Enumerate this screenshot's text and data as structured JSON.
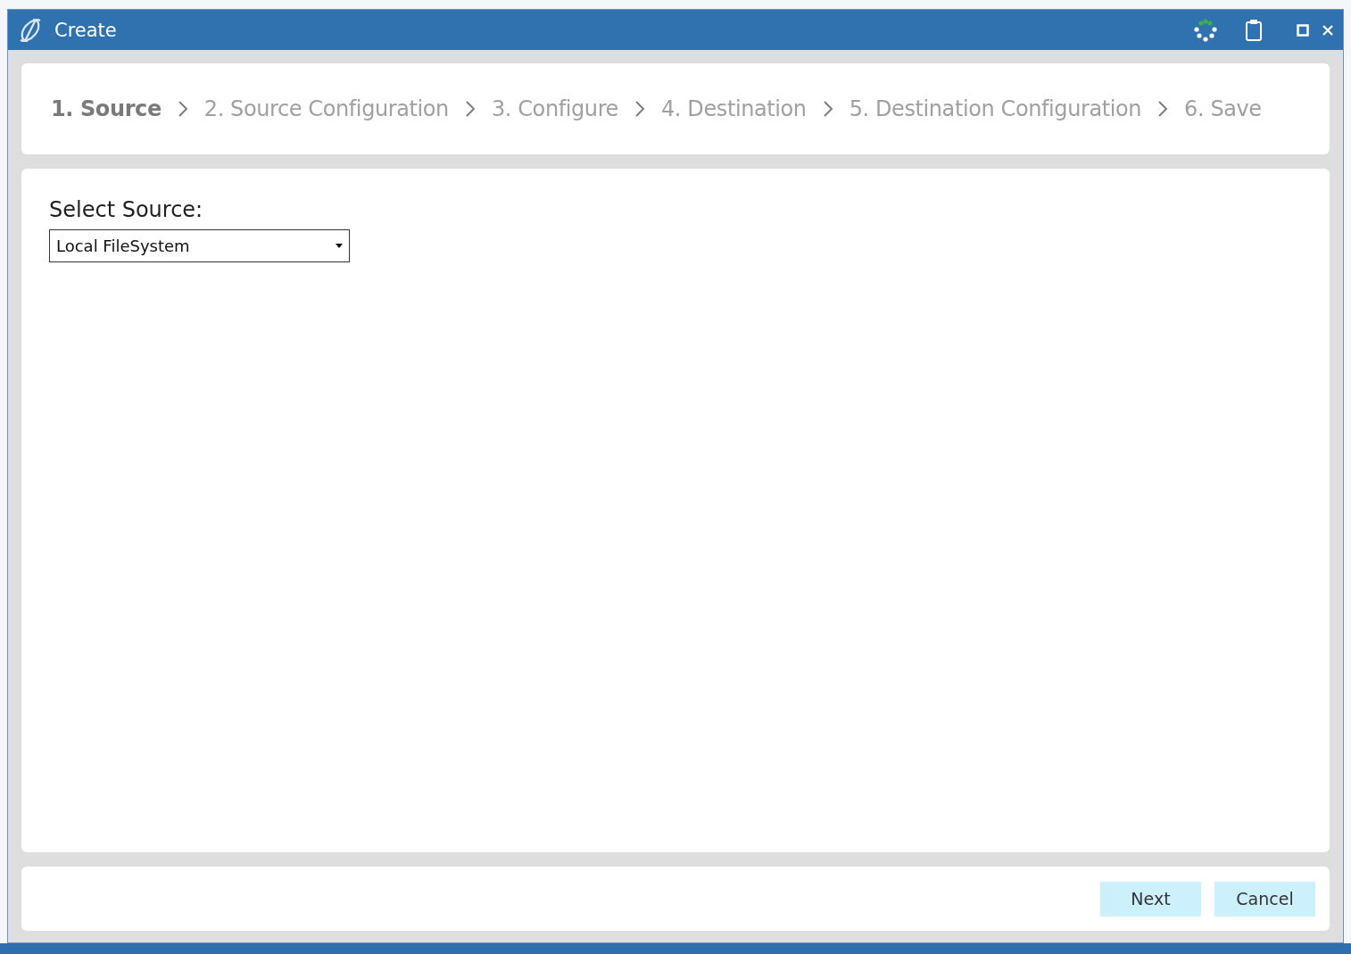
{
  "window": {
    "title": "Create"
  },
  "steps": [
    {
      "label": "1. Source",
      "selected": true
    },
    {
      "label": "2. Source Configuration",
      "selected": false
    },
    {
      "label": "3. Configure",
      "selected": false
    },
    {
      "label": "4. Destination",
      "selected": false
    },
    {
      "label": "5. Destination Configuration",
      "selected": false
    },
    {
      "label": "6. Save",
      "selected": false
    }
  ],
  "source": {
    "label": "Select Source:",
    "value": "Local FileSystem"
  },
  "buttons": [
    {
      "label": "Next"
    },
    {
      "label": "Cancel"
    }
  ]
}
